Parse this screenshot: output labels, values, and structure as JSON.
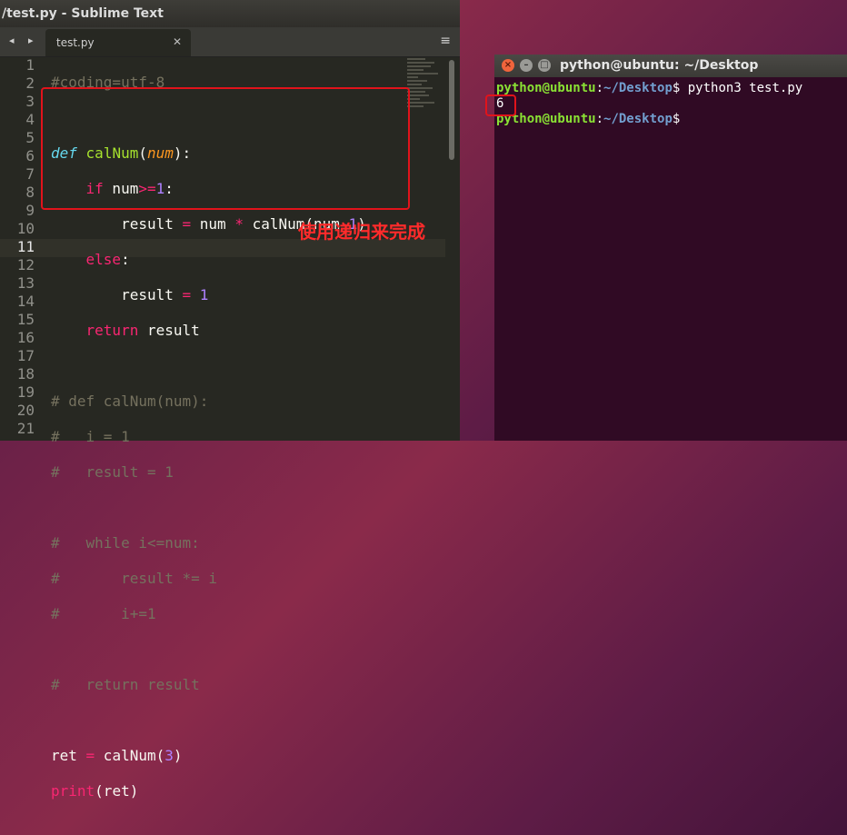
{
  "sublime": {
    "title": "/test.py - Sublime Text",
    "nav_arrows": "◂ ▸",
    "tab_label": "test.py",
    "tab_close": "✕",
    "menu_icon": "≡"
  },
  "editor": {
    "line_numbers": [
      "1",
      "2",
      "3",
      "4",
      "5",
      "6",
      "7",
      "8",
      "9",
      "10",
      "11",
      "12",
      "13",
      "14",
      "15",
      "16",
      "17",
      "18",
      "19",
      "20",
      "21"
    ],
    "active_line": "11"
  },
  "annotation": {
    "text": "使用递归来完成"
  },
  "terminal": {
    "title": "python@ubuntu: ~/Desktop",
    "prompt_user": "python@ubuntu",
    "prompt_sep": ":",
    "prompt_path": "~/Desktop",
    "prompt_symbol": "$",
    "command": " python3 test.py",
    "output": "6"
  },
  "colors": {
    "annotation_red": "#e1131b",
    "editor_bg": "#272822",
    "terminal_bg": "#300a24"
  }
}
